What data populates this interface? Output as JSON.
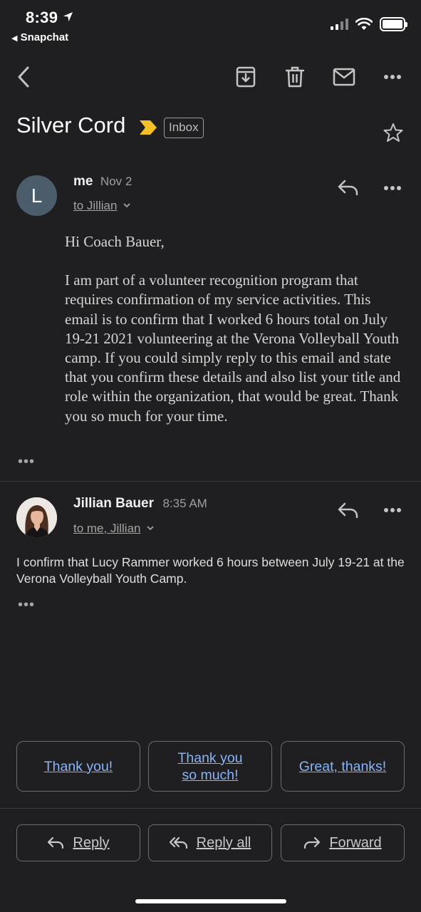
{
  "status_bar": {
    "time": "8:39",
    "back_app": "Snapchat"
  },
  "toolbar": {
    "back_icon": "chevron-left-icon",
    "archive_icon": "archive-icon",
    "delete_icon": "trash-icon",
    "mark_unread_icon": "mail-icon",
    "more_icon": "more-horizontal-icon"
  },
  "thread": {
    "subject": "Silver Cord",
    "label": "Inbox",
    "important_color": "#f6bf26"
  },
  "messages": [
    {
      "avatar_letter": "L",
      "avatar_color": "#4b5d6b",
      "sender": "me",
      "date": "Nov 2",
      "to": "to Jillian",
      "body": [
        "Hi Coach Bauer,",
        "I am part of a volunteer recognition program that requires confirmation of my service activities. This email is to confirm that I worked 6 hours total on July 19-21 2021 volunteering at the Verona Volleyball Youth camp. If you could simply reply to this email and state that you confirm these details and also list your title and role within the organization, that would be great. Thank you so much for your time."
      ],
      "trimmed": "•••"
    },
    {
      "sender": "Jillian Bauer",
      "date": "8:35 AM",
      "to": "to me, Jillian",
      "body": "I confirm that Lucy Rammer worked 6 hours between July 19-21 at the Verona Volleyball Youth Camp.",
      "trimmed": "•••"
    }
  ],
  "smart_replies": [
    {
      "line1": "Thank you!",
      "line2": ""
    },
    {
      "line1": "Thank you",
      "line2": "so much!"
    },
    {
      "line1": "Great, thanks!",
      "line2": ""
    }
  ],
  "actions": {
    "reply": "Reply",
    "reply_all": "Reply all",
    "forward": "Forward"
  },
  "colors": {
    "background": "#1f1f21",
    "link": "#8ab4f8"
  }
}
